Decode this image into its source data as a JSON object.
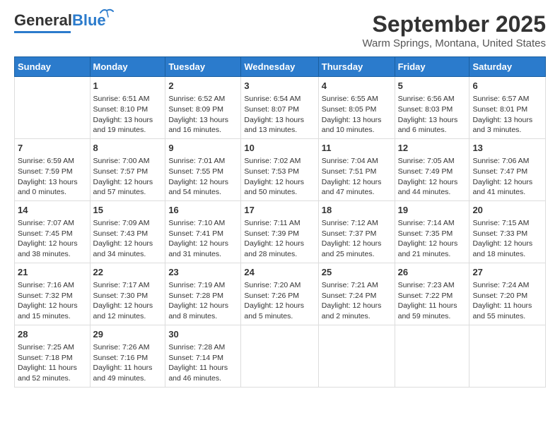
{
  "header": {
    "logo_general": "General",
    "logo_blue": "Blue",
    "month_title": "September 2025",
    "location": "Warm Springs, Montana, United States"
  },
  "weekdays": [
    "Sunday",
    "Monday",
    "Tuesday",
    "Wednesday",
    "Thursday",
    "Friday",
    "Saturday"
  ],
  "weeks": [
    [
      {
        "day": "",
        "info": ""
      },
      {
        "day": "1",
        "info": "Sunrise: 6:51 AM\nSunset: 8:10 PM\nDaylight: 13 hours\nand 19 minutes."
      },
      {
        "day": "2",
        "info": "Sunrise: 6:52 AM\nSunset: 8:09 PM\nDaylight: 13 hours\nand 16 minutes."
      },
      {
        "day": "3",
        "info": "Sunrise: 6:54 AM\nSunset: 8:07 PM\nDaylight: 13 hours\nand 13 minutes."
      },
      {
        "day": "4",
        "info": "Sunrise: 6:55 AM\nSunset: 8:05 PM\nDaylight: 13 hours\nand 10 minutes."
      },
      {
        "day": "5",
        "info": "Sunrise: 6:56 AM\nSunset: 8:03 PM\nDaylight: 13 hours\nand 6 minutes."
      },
      {
        "day": "6",
        "info": "Sunrise: 6:57 AM\nSunset: 8:01 PM\nDaylight: 13 hours\nand 3 minutes."
      }
    ],
    [
      {
        "day": "7",
        "info": "Sunrise: 6:59 AM\nSunset: 7:59 PM\nDaylight: 13 hours\nand 0 minutes."
      },
      {
        "day": "8",
        "info": "Sunrise: 7:00 AM\nSunset: 7:57 PM\nDaylight: 12 hours\nand 57 minutes."
      },
      {
        "day": "9",
        "info": "Sunrise: 7:01 AM\nSunset: 7:55 PM\nDaylight: 12 hours\nand 54 minutes."
      },
      {
        "day": "10",
        "info": "Sunrise: 7:02 AM\nSunset: 7:53 PM\nDaylight: 12 hours\nand 50 minutes."
      },
      {
        "day": "11",
        "info": "Sunrise: 7:04 AM\nSunset: 7:51 PM\nDaylight: 12 hours\nand 47 minutes."
      },
      {
        "day": "12",
        "info": "Sunrise: 7:05 AM\nSunset: 7:49 PM\nDaylight: 12 hours\nand 44 minutes."
      },
      {
        "day": "13",
        "info": "Sunrise: 7:06 AM\nSunset: 7:47 PM\nDaylight: 12 hours\nand 41 minutes."
      }
    ],
    [
      {
        "day": "14",
        "info": "Sunrise: 7:07 AM\nSunset: 7:45 PM\nDaylight: 12 hours\nand 38 minutes."
      },
      {
        "day": "15",
        "info": "Sunrise: 7:09 AM\nSunset: 7:43 PM\nDaylight: 12 hours\nand 34 minutes."
      },
      {
        "day": "16",
        "info": "Sunrise: 7:10 AM\nSunset: 7:41 PM\nDaylight: 12 hours\nand 31 minutes."
      },
      {
        "day": "17",
        "info": "Sunrise: 7:11 AM\nSunset: 7:39 PM\nDaylight: 12 hours\nand 28 minutes."
      },
      {
        "day": "18",
        "info": "Sunrise: 7:12 AM\nSunset: 7:37 PM\nDaylight: 12 hours\nand 25 minutes."
      },
      {
        "day": "19",
        "info": "Sunrise: 7:14 AM\nSunset: 7:35 PM\nDaylight: 12 hours\nand 21 minutes."
      },
      {
        "day": "20",
        "info": "Sunrise: 7:15 AM\nSunset: 7:33 PM\nDaylight: 12 hours\nand 18 minutes."
      }
    ],
    [
      {
        "day": "21",
        "info": "Sunrise: 7:16 AM\nSunset: 7:32 PM\nDaylight: 12 hours\nand 15 minutes."
      },
      {
        "day": "22",
        "info": "Sunrise: 7:17 AM\nSunset: 7:30 PM\nDaylight: 12 hours\nand 12 minutes."
      },
      {
        "day": "23",
        "info": "Sunrise: 7:19 AM\nSunset: 7:28 PM\nDaylight: 12 hours\nand 8 minutes."
      },
      {
        "day": "24",
        "info": "Sunrise: 7:20 AM\nSunset: 7:26 PM\nDaylight: 12 hours\nand 5 minutes."
      },
      {
        "day": "25",
        "info": "Sunrise: 7:21 AM\nSunset: 7:24 PM\nDaylight: 12 hours\nand 2 minutes."
      },
      {
        "day": "26",
        "info": "Sunrise: 7:23 AM\nSunset: 7:22 PM\nDaylight: 11 hours\nand 59 minutes."
      },
      {
        "day": "27",
        "info": "Sunrise: 7:24 AM\nSunset: 7:20 PM\nDaylight: 11 hours\nand 55 minutes."
      }
    ],
    [
      {
        "day": "28",
        "info": "Sunrise: 7:25 AM\nSunset: 7:18 PM\nDaylight: 11 hours\nand 52 minutes."
      },
      {
        "day": "29",
        "info": "Sunrise: 7:26 AM\nSunset: 7:16 PM\nDaylight: 11 hours\nand 49 minutes."
      },
      {
        "day": "30",
        "info": "Sunrise: 7:28 AM\nSunset: 7:14 PM\nDaylight: 11 hours\nand 46 minutes."
      },
      {
        "day": "",
        "info": ""
      },
      {
        "day": "",
        "info": ""
      },
      {
        "day": "",
        "info": ""
      },
      {
        "day": "",
        "info": ""
      }
    ]
  ]
}
